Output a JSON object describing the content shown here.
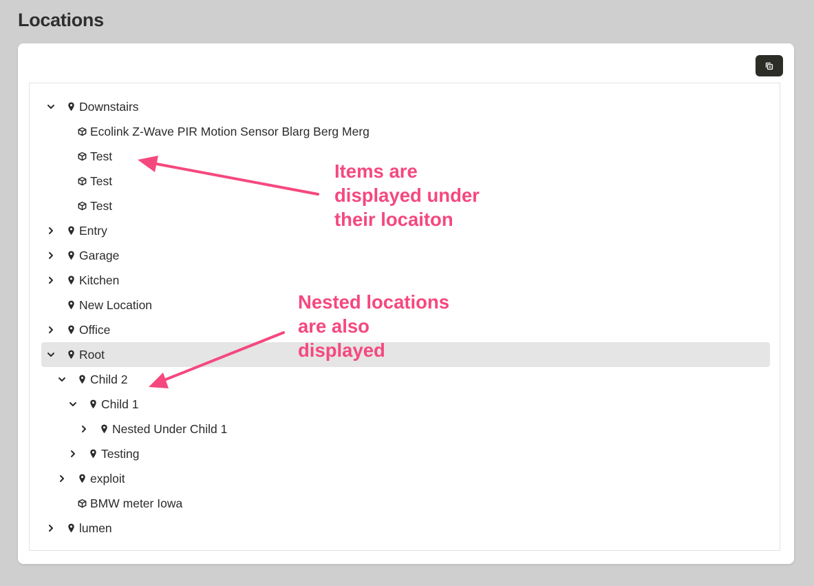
{
  "page": {
    "title": "Locations"
  },
  "toolbar": {
    "copy_button_icon": "copy-icon"
  },
  "colors": {
    "background": "#cfcfcf",
    "card": "#ffffff",
    "selected_row": "#e5e5e5",
    "annotation": "#f5487f",
    "button": "#2d2d28"
  },
  "tree": [
    {
      "label": "Downstairs",
      "type": "location",
      "depth": 0,
      "expanded": true
    },
    {
      "label": "Ecolink Z-Wave PIR Motion Sensor Blarg Berg Merg",
      "type": "item",
      "depth": 1
    },
    {
      "label": "Test",
      "type": "item",
      "depth": 1
    },
    {
      "label": "Test",
      "type": "item",
      "depth": 1
    },
    {
      "label": "Test",
      "type": "item",
      "depth": 1
    },
    {
      "label": "Entry",
      "type": "location",
      "depth": 0,
      "expanded": false
    },
    {
      "label": "Garage",
      "type": "location",
      "depth": 0,
      "expanded": false
    },
    {
      "label": "Kitchen",
      "type": "location",
      "depth": 0,
      "expanded": false
    },
    {
      "label": "New Location",
      "type": "location",
      "depth": 0,
      "expanded": null
    },
    {
      "label": "Office",
      "type": "location",
      "depth": 0,
      "expanded": false
    },
    {
      "label": "Root",
      "type": "location",
      "depth": 0,
      "expanded": true,
      "selected": true
    },
    {
      "label": "Child 2",
      "type": "location",
      "depth": 1,
      "expanded": true
    },
    {
      "label": "Child 1",
      "type": "location",
      "depth": 2,
      "expanded": true
    },
    {
      "label": "Nested Under Child 1",
      "type": "location",
      "depth": 3,
      "expanded": false
    },
    {
      "label": "Testing",
      "type": "location",
      "depth": 2,
      "expanded": false
    },
    {
      "label": "exploit",
      "type": "location",
      "depth": 1,
      "expanded": false
    },
    {
      "label": "BMW meter Iowa",
      "type": "item",
      "depth": 1
    },
    {
      "label": "lumen",
      "type": "location",
      "depth": 0,
      "expanded": false
    }
  ],
  "annotations": {
    "items": [
      "Items are",
      "displayed under",
      "their locaiton"
    ],
    "nested": [
      "Nested locations",
      "are also",
      "displayed"
    ]
  }
}
